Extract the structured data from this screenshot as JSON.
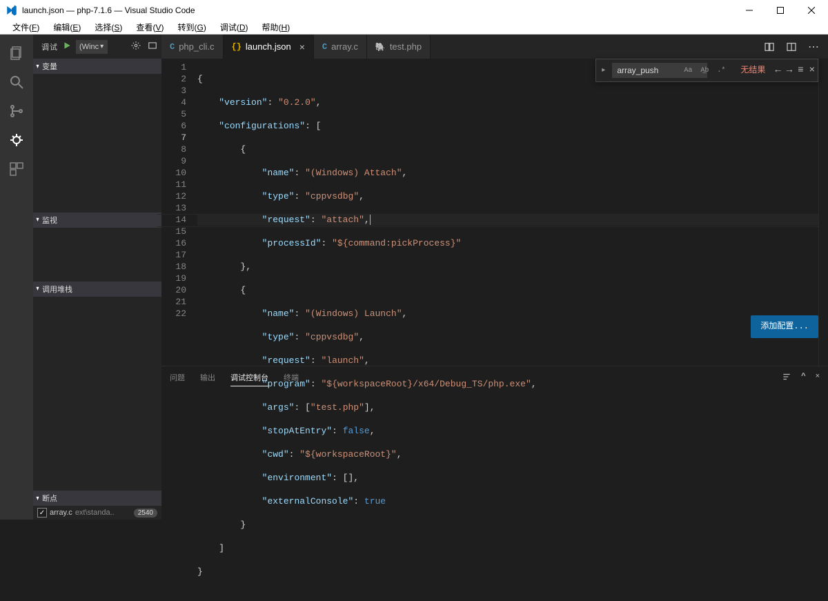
{
  "window": {
    "title": "launch.json — php-7.1.6 — Visual Studio Code"
  },
  "menubar": [
    {
      "label": "文件",
      "accel": "F"
    },
    {
      "label": "编辑",
      "accel": "E"
    },
    {
      "label": "选择",
      "accel": "S"
    },
    {
      "label": "查看",
      "accel": "V"
    },
    {
      "label": "转到",
      "accel": "G"
    },
    {
      "label": "调试",
      "accel": "D"
    },
    {
      "label": "帮助",
      "accel": "H"
    }
  ],
  "activity": {
    "items": [
      "files-icon",
      "search-icon",
      "git-icon",
      "debug-icon",
      "extensions-icon"
    ],
    "active_index": 3
  },
  "debug_view": {
    "title": "调试",
    "config_select": "(Winc",
    "sections": {
      "variables": "变量",
      "watch": "监视",
      "callstack": "调用堆栈",
      "breakpoints": "断点"
    },
    "breakpoints": [
      {
        "checked": true,
        "file": "array.c",
        "path": "ext\\standa..",
        "line": "2540"
      }
    ]
  },
  "tabs": [
    {
      "icon": "c",
      "label": "php_cli.c",
      "active": false,
      "close": false
    },
    {
      "icon": "braces",
      "label": "launch.json",
      "active": true,
      "close": true
    },
    {
      "icon": "c",
      "label": "array.c",
      "active": false,
      "close": false
    },
    {
      "icon": "php",
      "label": "test.php",
      "active": false,
      "close": false
    }
  ],
  "editor": {
    "current_line": 7,
    "lines": 22,
    "add_config_button": "添加配置...",
    "code": {
      "version_key": "version",
      "version_val": "0.2.0",
      "configurations_key": "configurations",
      "cfg1": {
        "name_key": "name",
        "name_val": "(Windows) Attach",
        "type_key": "type",
        "type_val": "cppvsdbg",
        "request_key": "request",
        "request_val": "attach",
        "processId_key": "processId",
        "processId_val": "${command:pickProcess}"
      },
      "cfg2": {
        "name_key": "name",
        "name_val": "(Windows) Launch",
        "type_key": "type",
        "type_val": "cppvsdbg",
        "request_key": "request",
        "request_val": "launch",
        "program_key": "program",
        "program_val": "${workspaceRoot}/x64/Debug_TS/php.exe",
        "args_key": "args",
        "args_val": "test.php",
        "stopAtEntry_key": "stopAtEntry",
        "stopAtEntry_val": "false",
        "cwd_key": "cwd",
        "cwd_val": "${workspaceRoot}",
        "environment_key": "environment",
        "externalConsole_key": "externalConsole",
        "externalConsole_val": "true"
      }
    }
  },
  "find": {
    "query": "array_push",
    "options": {
      "case": "Aa",
      "word": "A͟b",
      "regex": ".*"
    },
    "result": "无结果"
  },
  "panel": {
    "tabs": [
      "问题",
      "输出",
      "调试控制台",
      "终端"
    ],
    "active_index": 2
  }
}
